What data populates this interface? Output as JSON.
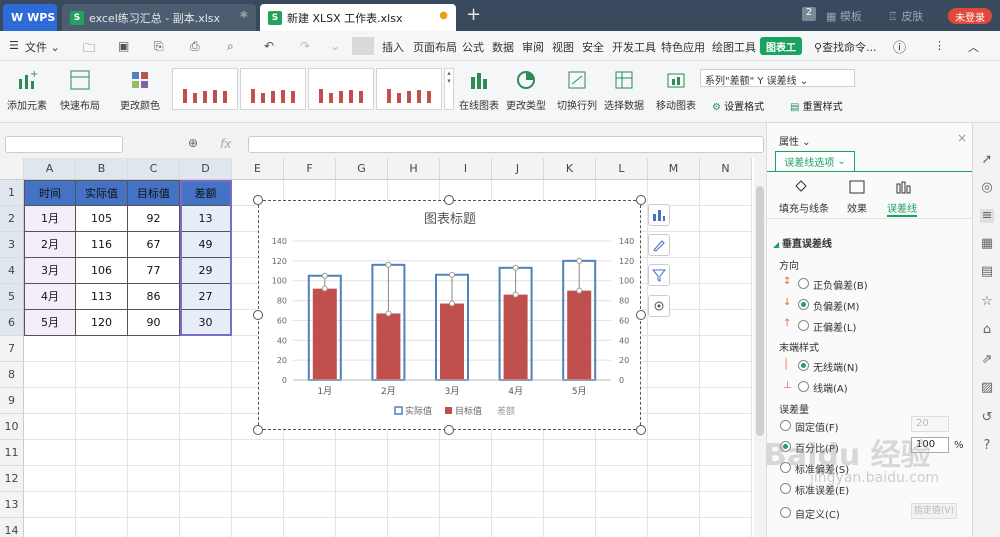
{
  "tabs": {
    "app": "WPS",
    "tab1": "excel练习汇总 - 副本.xlsx",
    "tab2": "新建 XLSX 工作表.xlsx",
    "badge": "2",
    "template": "模板",
    "skin": "皮肤",
    "login": "未登录"
  },
  "menu": {
    "file": "文件",
    "items": [
      "插入",
      "页面布局",
      "公式",
      "数据",
      "审阅",
      "视图",
      "安全",
      "开发工具",
      "特色应用",
      "绘图工具"
    ],
    "chart_tools": "图表工",
    "search": "查找命令..."
  },
  "ribbon": {
    "add_element": "添加元素",
    "quick_layout": "快速布局",
    "change_color": "更改颜色",
    "online_chart": "在线图表",
    "change_type": "更改类型",
    "switch_rowcol": "切换行列",
    "select_data": "选择数据",
    "move_chart": "移动图表",
    "series_select": "系列\"差额\" Y 误差线",
    "format_selection": "设置格式",
    "reset_style": "重置样式"
  },
  "formula": {
    "fx": "fx"
  },
  "grid": {
    "columns": [
      "A",
      "B",
      "C",
      "D",
      "E",
      "F",
      "G",
      "H",
      "I",
      "J",
      "K",
      "L",
      "M",
      "N"
    ],
    "rows": [
      "1",
      "2",
      "3",
      "4",
      "5",
      "6",
      "7",
      "8",
      "9",
      "10",
      "11",
      "12",
      "13",
      "14"
    ],
    "header": [
      "时间",
      "实际值",
      "目标值",
      "差额"
    ],
    "data": [
      [
        "1月",
        "105",
        "92",
        "13"
      ],
      [
        "2月",
        "116",
        "67",
        "49"
      ],
      [
        "3月",
        "106",
        "77",
        "29"
      ],
      [
        "4月",
        "113",
        "86",
        "27"
      ],
      [
        "5月",
        "120",
        "90",
        "30"
      ]
    ]
  },
  "chart_data": {
    "type": "bar",
    "title": "图表标题",
    "categories": [
      "1月",
      "2月",
      "3月",
      "4月",
      "5月"
    ],
    "series": [
      {
        "name": "实际值",
        "values": [
          105,
          116,
          106,
          113,
          120
        ],
        "color": "#4f81bd",
        "style": "outline"
      },
      {
        "name": "目标值",
        "values": [
          92,
          67,
          77,
          86,
          90
        ],
        "color": "#c0504d",
        "style": "filled"
      },
      {
        "name": "差额",
        "values": [
          13,
          49,
          29,
          27,
          30
        ],
        "style": "error-bar"
      }
    ],
    "ylim": [
      0,
      140
    ],
    "yticks": [
      0,
      20,
      40,
      60,
      80,
      100,
      120,
      140
    ],
    "grid": true,
    "legend": "bottom"
  },
  "panel": {
    "title": "属性",
    "tab": "误差线选项",
    "sub_fill": "填充与线条",
    "sub_effect": "效果",
    "sub_errbar": "误差线",
    "section": "垂直误差线",
    "direction": "方向",
    "dir_both": "正负偏差(B)",
    "dir_minus": "负偏差(M)",
    "dir_plus": "正偏差(L)",
    "end_style": "末端样式",
    "no_cap": "无线端(N)",
    "cap": "线端(A)",
    "amount": "误差量",
    "fixed": "固定值(F)",
    "fixed_val": "20",
    "percent": "百分比(P)",
    "percent_val": "100",
    "percent_unit": "%",
    "stdev": "标准偏差(S)",
    "sterr": "标准误差(E)",
    "custom": "自定义(C)",
    "custom_btn": "指定值(V)"
  },
  "watermark": {
    "brand": "Baidu 经验",
    "url": "jingyan.baidu.com"
  }
}
